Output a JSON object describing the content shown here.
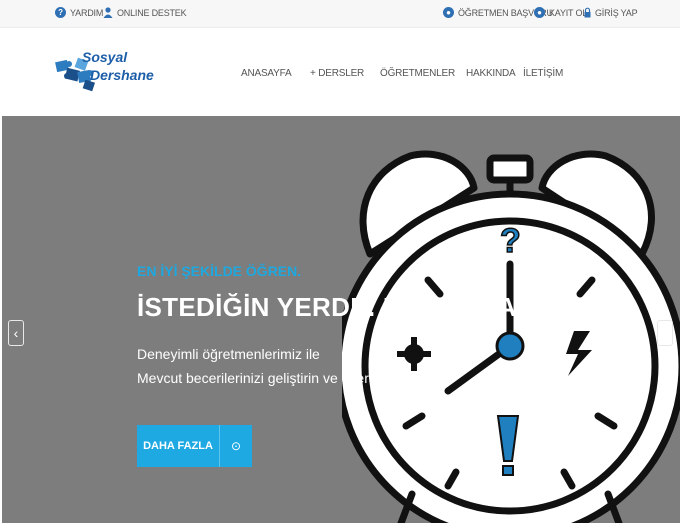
{
  "topbar": {
    "help": "YARDIM",
    "online_support": "ONLINE DESTEK",
    "teacher_apply": "ÖĞRETMEN BAŞVURU",
    "register": "KAYIT OL",
    "login": "GİRİŞ YAP"
  },
  "logo": {
    "line1": "Sosyal",
    "line2": "Dershane"
  },
  "nav": {
    "home": "ANASAYFA",
    "courses": "+ DERSLER",
    "teachers": "ÖĞRETMENLER",
    "about": "HAKKINDA",
    "contact": "İLETİŞİM"
  },
  "hero": {
    "eyebrow": "EN İYİ ŞEKİLDE ÖĞREN.",
    "headline": "İSTEDİĞİN YERDE. ZAMANDA.",
    "desc_line1": "Deneyimli öğretmenlerimiz ile",
    "desc_line2": "Mevcut becerilerinizi geliştirin ve üzerine ekleyin.",
    "cta_label": "DAHA FAZLA",
    "prev": "‹",
    "next": "›"
  },
  "colors": {
    "accent": "#1fa9e3",
    "hero_bg": "#7d7d7d",
    "brand_blue": "#2f6fb3"
  }
}
